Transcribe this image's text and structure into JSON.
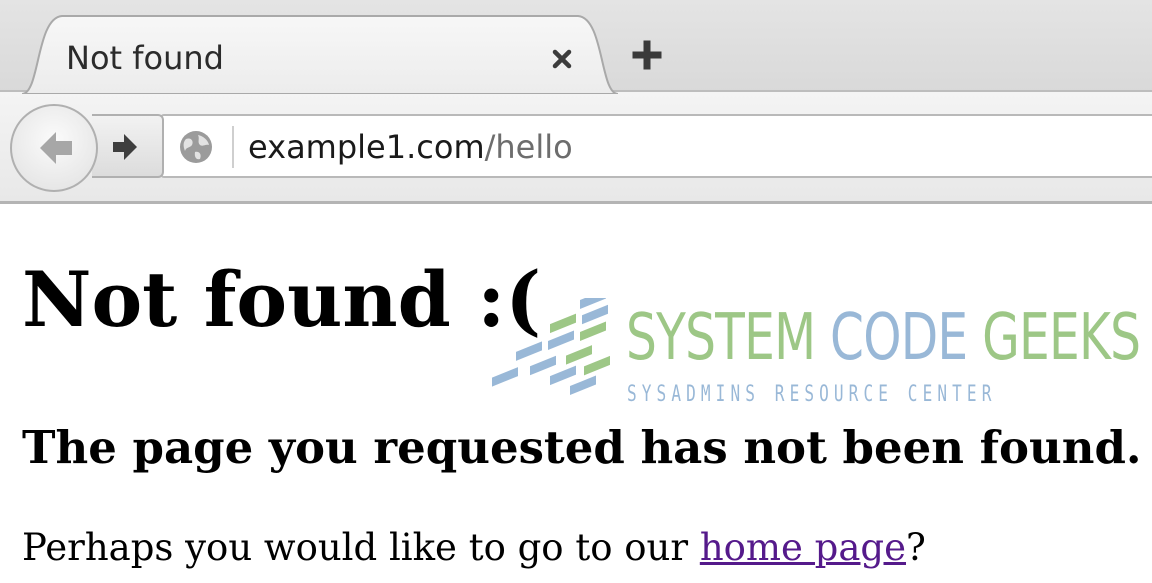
{
  "browser": {
    "tab": {
      "title": "Not found",
      "close_icon": "close-icon"
    },
    "new_tab_icon": "plus-icon",
    "nav": {
      "back_icon": "arrow-left-icon",
      "forward_icon": "arrow-right-icon",
      "site_icon": "globe-icon"
    },
    "url": {
      "host": "example1.com",
      "path": "/hello"
    }
  },
  "page": {
    "heading": "Not found :(",
    "subheading": "The page you requested has not been found.",
    "message_prefix": "Perhaps you would like to go to our ",
    "link_label": "home page",
    "message_suffix": "?",
    "link_color": "#551a8b"
  },
  "watermark": {
    "title_word1": "SYSTEM",
    "title_word2": "CODE",
    "title_word3": "GEEKS",
    "subtitle": "SYSADMINS RESOURCE CENTER",
    "colors": {
      "green": "#93c17a",
      "blue": "#8fb1d3"
    }
  }
}
